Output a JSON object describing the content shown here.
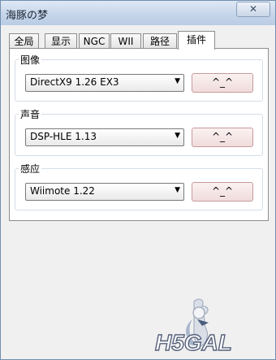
{
  "window": {
    "title": "海豚の梦",
    "close_glyph": "✕"
  },
  "tabs": [
    {
      "label": "全局",
      "active": false
    },
    {
      "label": "显示",
      "active": false
    },
    {
      "label": "NGC",
      "active": false
    },
    {
      "label": "WII",
      "active": false
    },
    {
      "label": "路径",
      "active": false
    },
    {
      "label": "插件",
      "active": true
    }
  ],
  "plugins": {
    "graphics": {
      "label": "图像",
      "selected": "DirectX9 1.26 EX3",
      "config_label": "^_^"
    },
    "audio": {
      "label": "声音",
      "selected": "DSP-HLE 1.13",
      "config_label": "^_^"
    },
    "input": {
      "label": "感应",
      "selected": "Wiimote 1.22",
      "config_label": "^_^"
    }
  },
  "watermark": {
    "text": "H5GAL"
  }
}
